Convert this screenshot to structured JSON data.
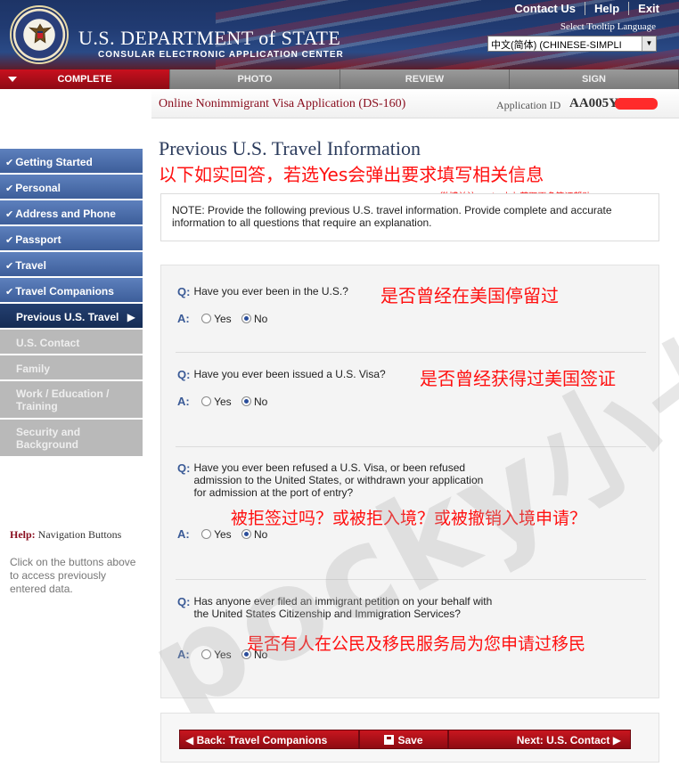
{
  "header": {
    "top_links": [
      "Contact Us",
      "Help",
      "Exit"
    ],
    "dept_title": "U.S. DEPARTMENT of STATE",
    "dept_subtitle": "CONSULAR ELECTRONIC APPLICATION CENTER",
    "tooltip_language_label": "Select Tooltip Language",
    "language_selected": "中文(简体) (CHINESE-SIMPLI"
  },
  "steps": [
    "COMPLETE",
    "PHOTO",
    "REVIEW",
    "SIGN"
  ],
  "app_bar": {
    "title": "Online Nonimmigrant Visa Application (DS-160)",
    "id_label": "Application ID",
    "id_value": "AA005Y"
  },
  "sidenav": {
    "items": [
      {
        "label": "Getting Started",
        "state": "done"
      },
      {
        "label": "Personal",
        "state": "done"
      },
      {
        "label": "Address and Phone",
        "state": "done"
      },
      {
        "label": "Passport",
        "state": "done"
      },
      {
        "label": "Travel",
        "state": "done"
      },
      {
        "label": "Travel Companions",
        "state": "done"
      },
      {
        "label": "Previous U.S. Travel",
        "state": "current"
      },
      {
        "label": "U.S. Contact",
        "state": "todo"
      },
      {
        "label": "Family",
        "state": "todo"
      },
      {
        "label": "Work / Education / Training",
        "state": "todo"
      },
      {
        "label": "Security and Background",
        "state": "todo"
      }
    ],
    "help_title_prefix": "Help:",
    "help_title": "Navigation Buttons",
    "help_text": "Click on the buttons above to access previously entered data."
  },
  "main": {
    "page_title": "Previous U.S. Travel Information",
    "annotation_top": "以下如实回答，若选Yes会弹出要求填写相关信息",
    "annotation_small": "微博关注pocky小七获取更多签证帮助",
    "note": "NOTE: Provide the following previous U.S. travel information. Provide complete and accurate information to all questions that require an explanation.",
    "q_label": "Q:",
    "a_label": "A:",
    "yes_label": "Yes",
    "no_label": "No",
    "questions": [
      {
        "text": "Have you ever been in the U.S.?",
        "annotation": "是否曾经在美国停留过",
        "answer": "No"
      },
      {
        "text": "Have you ever been issued a U.S. Visa?",
        "annotation": "是否曾经获得过美国签证",
        "answer": "No"
      },
      {
        "text": "Have you ever been refused a U.S. Visa, or been refused admission to the United States, or withdrawn your application for admission at the port of entry?",
        "annotation": "被拒签过吗？或被拒入境？或被撤销入境申请？",
        "answer": "No"
      },
      {
        "text": "Has anyone ever filed an immigrant petition on your behalf with the United States Citizenship and Immigration Services?",
        "annotation": "是否有人在公民及移民服务局为您申请过移民",
        "answer": "No"
      }
    ],
    "watermark": "pocky小七"
  },
  "buttons": {
    "back": "Back: Travel Companions",
    "save": "Save",
    "next": "Next: U.S. Contact"
  },
  "colors": {
    "header_navy": "#213b72",
    "active_red": "#c8101e",
    "nav_blue": "#4a6dab",
    "annotation_red": "#ff1010"
  }
}
